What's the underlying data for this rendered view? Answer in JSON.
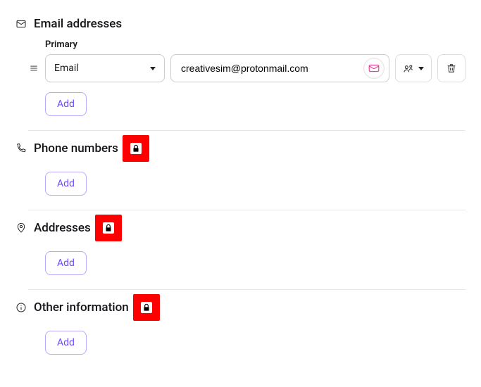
{
  "sections": {
    "email": {
      "title": "Email addresses",
      "primary_label": "Primary",
      "type_value": "Email",
      "email_value": "creativesim@protonmail.com",
      "add_label": "Add"
    },
    "phone": {
      "title": "Phone numbers",
      "add_label": "Add"
    },
    "address": {
      "title": "Addresses",
      "add_label": "Add"
    },
    "other": {
      "title": "Other information",
      "add_label": "Add"
    }
  }
}
